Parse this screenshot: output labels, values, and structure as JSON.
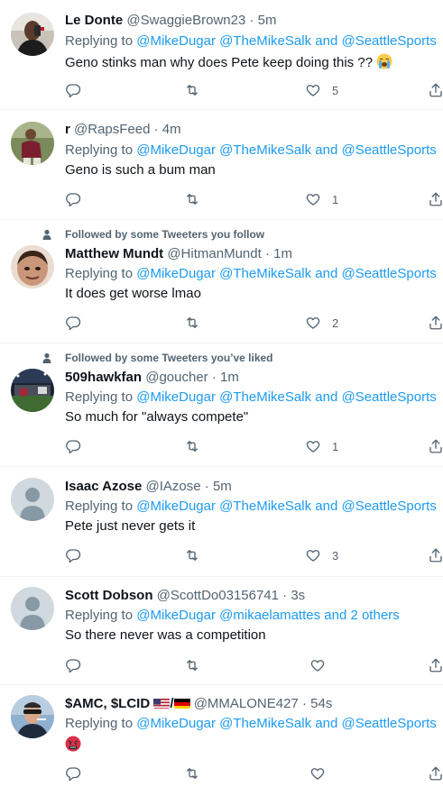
{
  "tweets": [
    {
      "name": "Le Donte",
      "handle": "@SwaggieBrown23",
      "time": "5m",
      "replying_prefix": "Replying to",
      "mentions": [
        "@MikeDugar",
        "@TheMikeSalk",
        "@SeattleSports"
      ],
      "and_word": "and",
      "text": "Geno stinks man why does Pete keep doing this ??",
      "text_emoji": "loudly-crying-face",
      "likes": "5",
      "avatar": "person-dark-shirt"
    },
    {
      "name": "r",
      "handle": "@RapsFeed",
      "time": "4m",
      "replying_prefix": "Replying to",
      "mentions": [
        "@MikeDugar",
        "@TheMikeSalk",
        "@SeattleSports"
      ],
      "and_word": "and",
      "text": "Geno is such a bum man",
      "likes": "1",
      "avatar": "athlete-maroon-jersey"
    },
    {
      "social": "Followed by some Tweeters you follow",
      "name": "Matthew Mundt",
      "handle": "@HitmanMundt",
      "time": "1m",
      "replying_prefix": "Replying to",
      "mentions": [
        "@MikeDugar",
        "@TheMikeSalk",
        "@SeattleSports"
      ],
      "and_word": "and",
      "text": "It does get worse lmao",
      "likes": "2",
      "avatar": "cartoon-face"
    },
    {
      "social": "Followed by some Tweeters you’ve liked",
      "name": "509hawkfan",
      "handle": "@goucher",
      "time": "1m",
      "replying_prefix": "Replying to",
      "mentions": [
        "@MikeDugar",
        "@TheMikeSalk",
        "@SeattleSports"
      ],
      "and_word": "and",
      "text": "So much for \"always compete\"",
      "likes": "1",
      "avatar": "stadium-photo"
    },
    {
      "name": "Isaac Azose",
      "handle": "@IAzose",
      "time": "5m",
      "replying_prefix": "Replying to",
      "mentions": [
        "@MikeDugar",
        "@TheMikeSalk",
        "@SeattleSports"
      ],
      "and_word": "and",
      "text": "Pete just never gets it",
      "likes": "3",
      "avatar": "default-avatar"
    },
    {
      "name": "Scott Dobson",
      "handle": "@ScottDo03156741",
      "time": "3s",
      "replying_prefix": "Replying to",
      "mentions": [
        "@MikeDugar",
        "@mikaelamattes"
      ],
      "others_text": "and 2 others",
      "text": "So there never was a competition",
      "likes": "",
      "avatar": "default-avatar"
    },
    {
      "name": "$AMC, $LCID",
      "name_flags": [
        "us-flag",
        "german-flag"
      ],
      "name_sep": "/",
      "handle": "@MMALONE427",
      "time": "54s",
      "replying_prefix": "Replying to",
      "mentions": [
        "@MikeDugar",
        "@TheMikeSalk",
        "@SeattleSports"
      ],
      "and_word": "and",
      "text": "",
      "text_emoji": "angry-face",
      "likes": "",
      "avatar": "man-sunglasses"
    }
  ],
  "dot": "·",
  "colors": {
    "accent": "#1d9bf0",
    "secondary_text": "#536471",
    "primary_text": "#0f1419",
    "divider": "#eff3f4"
  }
}
